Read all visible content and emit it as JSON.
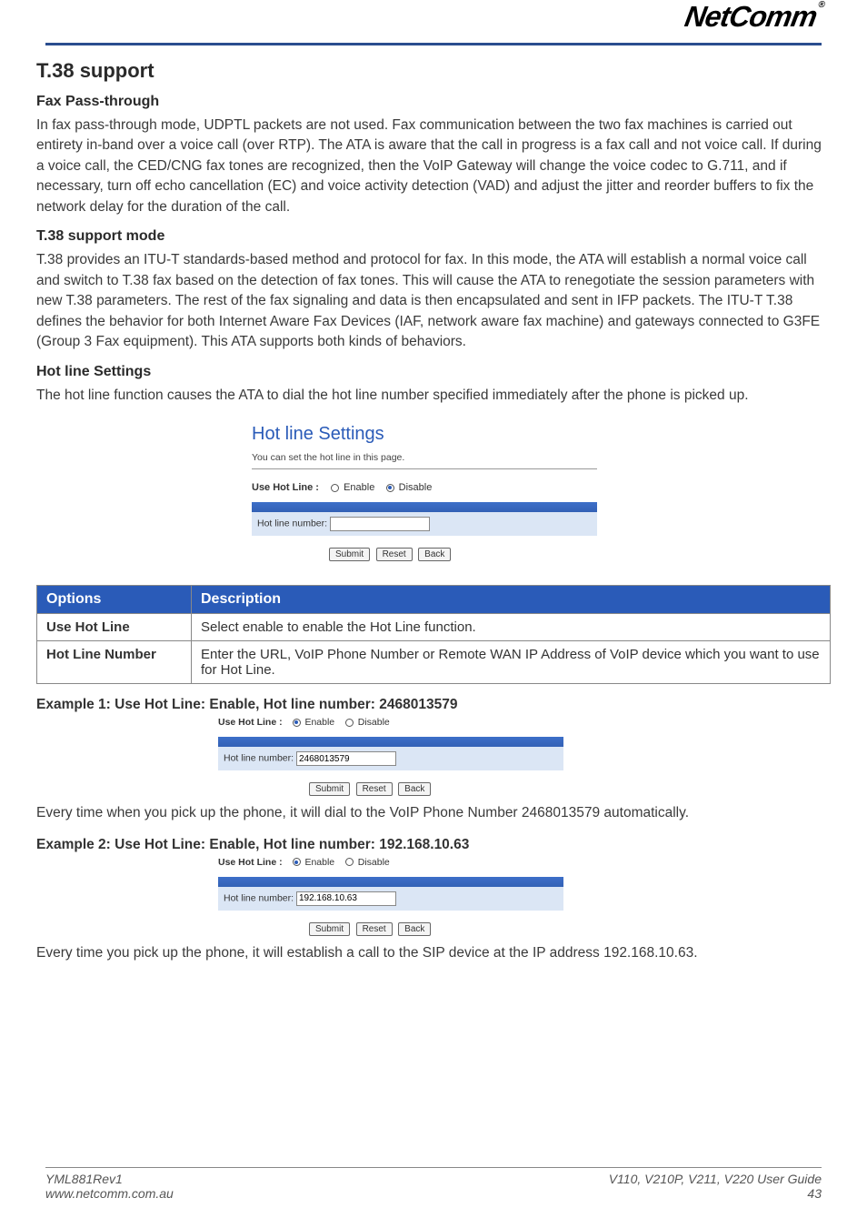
{
  "brand": "NetComm",
  "brand_reg": "®",
  "section_title": "T.38 support",
  "fax_passthrough": {
    "heading": "Fax Pass-through",
    "body": "In fax pass-through mode, UDPTL packets are not used. Fax communication between the two fax machines is carried out entirety in-band over a voice call (over RTP). The ATA is aware that the call in progress is a fax call and not voice call. If during a voice call, the CED/CNG fax tones are recognized, then the VoIP Gateway will change the voice codec to G.711, and if necessary, turn off echo cancellation (EC) and voice activity detection (VAD) and adjust the jitter and reorder buffers to fix the network delay for the duration of the call."
  },
  "t38_mode": {
    "heading": "T.38 support mode",
    "body": "T.38 provides an ITU-T standards-based method and protocol for fax. In this mode, the ATA will establish a normal voice call and switch to T.38 fax based on the detection of fax tones. This will cause the ATA to renegotiate the session parameters with new T.38 parameters. The rest of the fax signaling and data is then encapsulated and sent in IFP packets. The ITU-T T.38 defines the behavior for both Internet Aware Fax Devices (IAF, network aware fax machine) and gateways connected to G3FE (Group 3 Fax equipment). This ATA supports both kinds of behaviors."
  },
  "hotline": {
    "heading": "Hot line Settings",
    "body": "The hot line function causes the ATA to dial the hot line number specified immediately after the phone is picked up.",
    "panel_title": "Hot line Settings",
    "panel_sub": "You can set the hot line in this page.",
    "use_label": "Use Hot Line :",
    "enable": "Enable",
    "disable": "Disable",
    "number_label": "Hot line number:",
    "number_value": "",
    "submit": "Submit",
    "reset": "Reset",
    "back": "Back"
  },
  "opts_table": {
    "h_options": "Options",
    "h_description": "Description",
    "rows": [
      {
        "opt": "Use Hot Line",
        "desc": "Select enable to enable the Hot Line function."
      },
      {
        "opt": "Hot Line Number",
        "desc": "Enter the URL, VoIP Phone Number or Remote WAN IP Address of VoIP device which you want to use for Hot Line."
      }
    ]
  },
  "example1": {
    "title": "Example 1: Use Hot Line: Enable, Hot line number: 2468013579",
    "use_label": "Use Hot Line :",
    "enable": "Enable",
    "disable": "Disable",
    "number_label": "Hot line number:",
    "number_value": "2468013579",
    "submit": "Submit",
    "reset": "Reset",
    "back": "Back",
    "after": "Every time when you pick up the phone, it will dial to the VoIP Phone Number 2468013579 automatically."
  },
  "example2": {
    "title": "Example 2: Use Hot Line: Enable, Hot line number: 192.168.10.63",
    "use_label": "Use Hot Line :",
    "enable": "Enable",
    "disable": "Disable",
    "number_label": "Hot line number:",
    "number_value": "192.168.10.63",
    "submit": "Submit",
    "reset": "Reset",
    "back": "Back",
    "after": "Every time you pick up the phone, it will establish a call to the SIP device at the IP address 192.168.10.63."
  },
  "footer": {
    "left1": "YML881Rev1",
    "left2": "www.netcomm.com.au",
    "right1": "V110, V210P, V211, V220 User Guide",
    "right2": "43"
  }
}
